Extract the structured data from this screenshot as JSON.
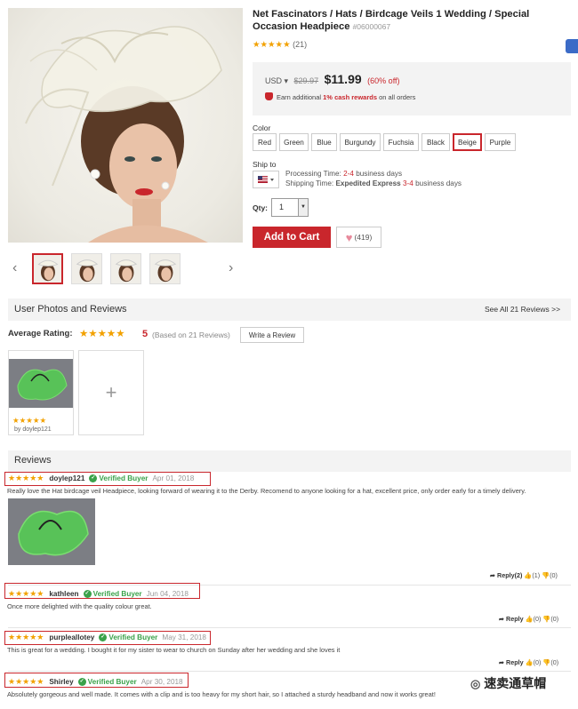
{
  "product": {
    "title": "Net Fascinators / Hats / Birdcage Veils 1 Wedding / Special Occasion Headpiece",
    "sku": "#06000067",
    "rating_stars": "★★★★★",
    "review_count": "(21)",
    "currency": "USD ▾",
    "old_price": "$29.97",
    "price": "$11.99",
    "discount": "(60% off)",
    "cash_prefix": "Earn additional",
    "cash_pct": "1% cash rewards",
    "cash_suffix": "on all orders",
    "color_label": "Color",
    "colors": [
      "Red",
      "Green",
      "Blue",
      "Burgundy",
      "Fuchsia",
      "Black",
      "Beige",
      "Purple"
    ],
    "selected_color": "Beige",
    "ship_label": "Ship to",
    "processing_prefix": "Processing Time:",
    "processing_days": "2-4",
    "processing_suffix": "business days",
    "shipping_prefix": "Shipping Time:",
    "shipping_method": "Expedited Express",
    "shipping_days": "3-4",
    "shipping_suffix": "business days",
    "qty_label": "Qty:",
    "qty_value": "1",
    "add_to_cart": "Add to Cart",
    "favorites": "(419)"
  },
  "user_photos": {
    "title": "User Photos and Reviews",
    "see_all": "See All 21 Reviews >>",
    "avg_label": "Average Rating:",
    "avg_stars": "★★★★★",
    "avg_value": "5",
    "based_on": "(Based on 21 Reviews)",
    "write_review": "Write a Review",
    "card_stars": "★★★★★",
    "card_by": "by   doylep121",
    "add_symbol": "+"
  },
  "reviews": {
    "title": "Reviews",
    "verified": "Verified Buyer",
    "items": [
      {
        "stars": "★★★★★",
        "name": "doylep121",
        "date": "Apr 01, 2018",
        "text": "Really love the Hat birdcage veil Headpiece, looking forward of wearing it to the Derby. Recomend to anyone looking for a hat, excellent price, only order early for a timely delivery.",
        "reply": "Reply(2)",
        "up": "(1)",
        "down": "(0)"
      },
      {
        "stars": "★★★★★",
        "name": "kathleen",
        "date": "Jun 04, 2018",
        "text": "Once more delighted with the quality colour great.",
        "reply": "Reply",
        "up": "(0)",
        "down": "(0)"
      },
      {
        "stars": "★★★★★",
        "name": "purpleallotey",
        "date": "May 31, 2018",
        "text": "This is great for a wedding. I bought it for my sister to wear to church on Sunday after her wedding and she loves it",
        "reply": "Reply",
        "up": "(0)",
        "down": "(0)"
      },
      {
        "stars": "★★★★★",
        "name": "Shirley",
        "date": "Apr 30, 2018",
        "text": "Absolutely gorgeous and well made. It comes with a clip and is too heavy for my short hair, so I attached a sturdy headband and now it works great!"
      }
    ]
  },
  "watermark": "速卖通草帽",
  "colors": {
    "accent": "#c9262c",
    "star": "#f2a100",
    "verified": "#3aa24a",
    "panel": "#f3f3f3"
  }
}
